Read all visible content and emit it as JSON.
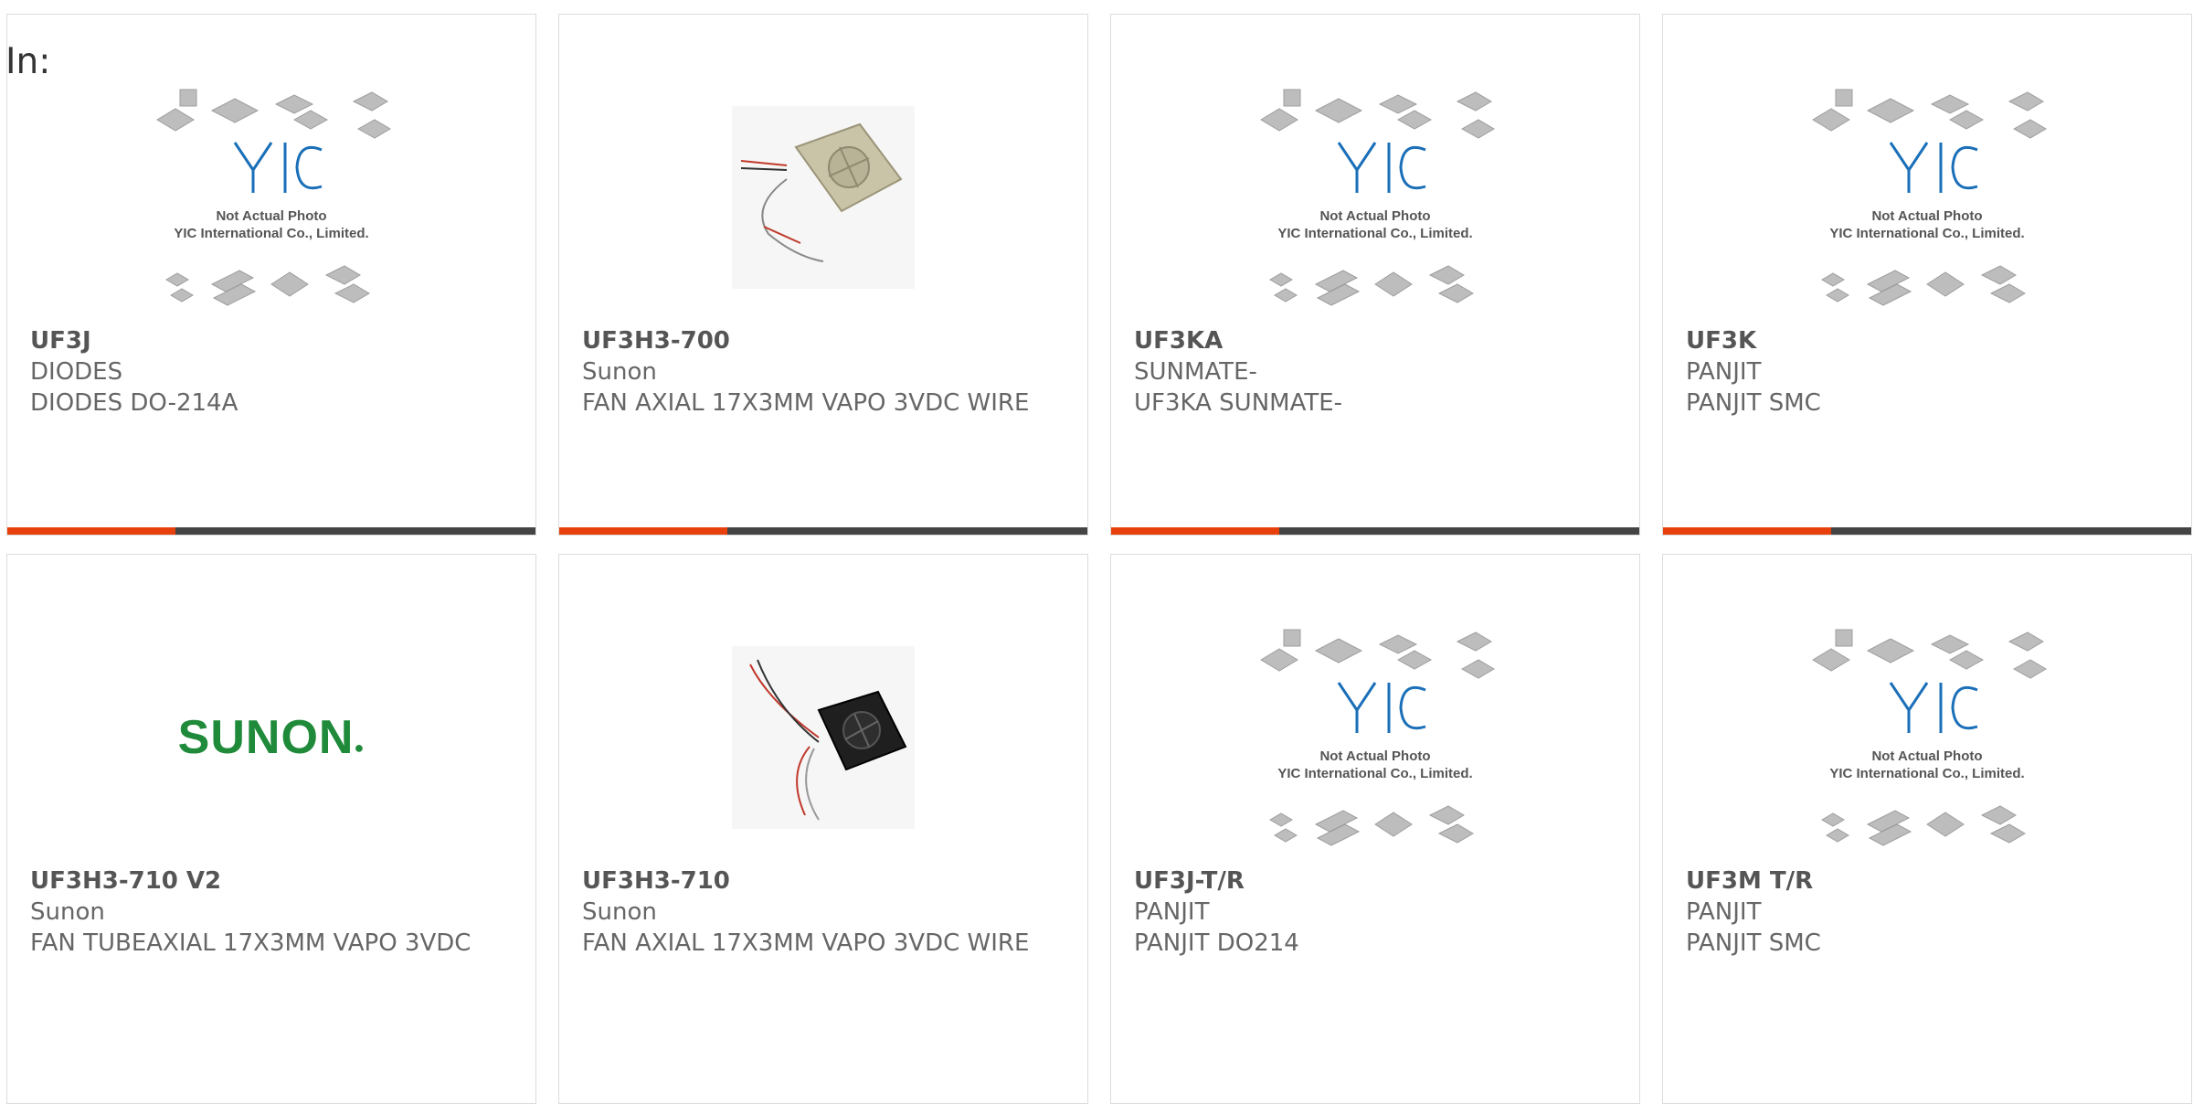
{
  "header": {
    "in_label": "In:"
  },
  "placeholder_image": {
    "line1": "Not Actual Photo",
    "line2": "YIC International Co., Limited."
  },
  "products": [
    {
      "part": "UF3J",
      "brand": "DIODES",
      "desc": "DIODES DO-214A",
      "image": "placeholder"
    },
    {
      "part": "UF3H3-700",
      "brand": "Sunon",
      "desc": "FAN AXIAL 17X3MM VAPO 3VDC WIRE",
      "image": "fan-beige"
    },
    {
      "part": "UF3KA",
      "brand": "SUNMATE-",
      "desc": "UF3KA SUNMATE-",
      "image": "placeholder"
    },
    {
      "part": "UF3K",
      "brand": "PANJIT",
      "desc": "PANJIT SMC",
      "image": "placeholder"
    },
    {
      "part": "UF3H3-710 V2",
      "brand": "Sunon",
      "desc": "FAN TUBEAXIAL 17X3MM VAPO 3VDC",
      "image": "sunon-logo"
    },
    {
      "part": "UF3H3-710",
      "brand": "Sunon",
      "desc": "FAN AXIAL 17X3MM VAPO 3VDC WIRE",
      "image": "fan-black"
    },
    {
      "part": "UF3J-T/R",
      "brand": "PANJIT",
      "desc": "PANJIT DO214",
      "image": "placeholder"
    },
    {
      "part": "UF3M T/R",
      "brand": "PANJIT",
      "desc": "PANJIT SMC",
      "image": "placeholder"
    }
  ],
  "sunon_logo_text": "SUNON",
  "colors": {
    "accent": "#e8400c",
    "bar": "#444444",
    "logo_green": "#1f8a3a",
    "yic_blue": "#1a6fb8"
  }
}
